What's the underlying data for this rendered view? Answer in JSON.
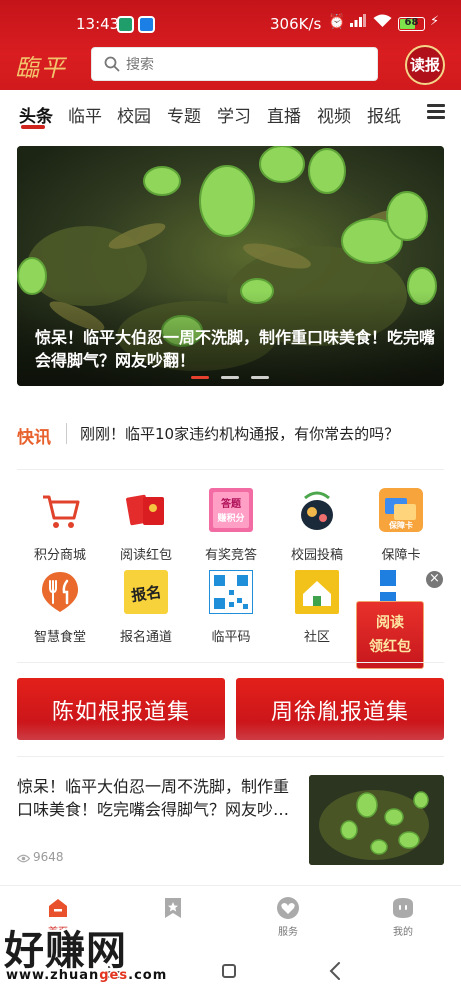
{
  "status_bar": {
    "time": "13:43",
    "net_speed": "306K/s",
    "battery": "68",
    "battery_level": 0.68
  },
  "header": {
    "logo": "臨平",
    "search_placeholder": "搜索",
    "read_badge": "读报"
  },
  "tabs": [
    {
      "label": "头条",
      "active": true
    },
    {
      "label": "临平"
    },
    {
      "label": "校园"
    },
    {
      "label": "专题"
    },
    {
      "label": "学习"
    },
    {
      "label": "直播"
    },
    {
      "label": "视频"
    },
    {
      "label": "报纸"
    }
  ],
  "banner": {
    "caption": "惊呆！临平大伯忍一周不洗脚，制作重口味美食！吃完嘴会得脚气？网友吵翻！",
    "slide_count": 3,
    "active_slide": 1
  },
  "flash_news": {
    "label": "快讯",
    "text": "刚刚！临平10家违约机构通报，有你常去的吗？"
  },
  "services": [
    {
      "label": "积分商城",
      "icon": "shopping-cart-icon",
      "icon_text": ""
    },
    {
      "label": "阅读红包",
      "icon": "red-envelope-icon",
      "icon_text": ""
    },
    {
      "label": "有奖竞答",
      "icon": "quiz-icon",
      "icon_text": "答题\n赚积分"
    },
    {
      "label": "校园投稿",
      "icon": "campus-submit-icon",
      "icon_text": ""
    },
    {
      "label": "保障卡",
      "icon": "security-card-icon",
      "icon_text": "保障卡"
    },
    {
      "label": "智慧食堂",
      "icon": "cutlery-icon",
      "icon_text": ""
    },
    {
      "label": "报名通道",
      "icon": "signup-icon",
      "icon_text": "报名"
    },
    {
      "label": "临平码",
      "icon": "qr-code-icon",
      "icon_text": ""
    },
    {
      "label": "社区",
      "icon": "community-icon",
      "icon_text": ""
    }
  ],
  "ad": {
    "close": "×",
    "line1": "阅读",
    "line2": "领红包"
  },
  "reports": [
    {
      "title": "陈如根报道集"
    },
    {
      "title": "周徐胤报道集"
    }
  ],
  "news": {
    "title": "惊呆！临平大伯忍一周不洗脚，制作重口味美食！吃完嘴会得脚气？网友吵…",
    "views": "9648"
  },
  "bottom_nav": [
    {
      "label": "首页",
      "icon": "home-icon",
      "active": true
    },
    {
      "label": "",
      "icon": "bookmark-star-icon"
    },
    {
      "label": "服务",
      "icon": "heart-service-icon"
    },
    {
      "label": "我的",
      "icon": "profile-icon"
    }
  ],
  "watermark": {
    "big": "好赚网",
    "small_prefix": "www.zhuan",
    "small_highlight": "ges",
    "small_suffix": ".com"
  },
  "colors": {
    "brand_red": "#d91d20",
    "flash_orange": "#e8612c",
    "gold": "#f2c46e"
  }
}
